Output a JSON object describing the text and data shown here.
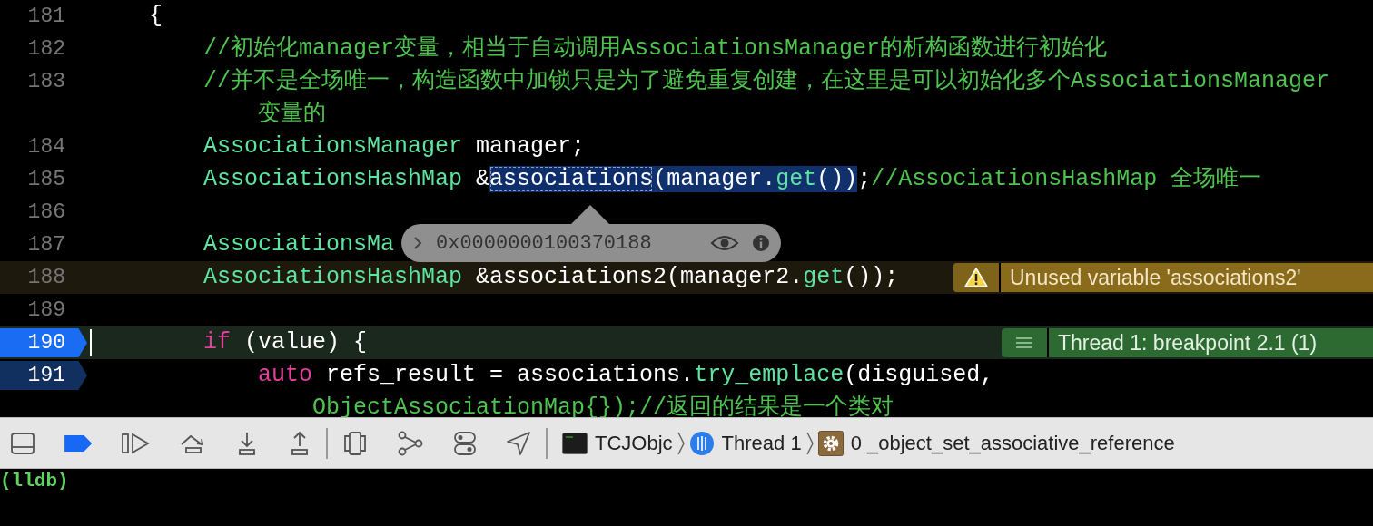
{
  "editor": {
    "lines": [
      {
        "number": "181",
        "tokens": [
          {
            "text": "    {",
            "kind": "plain"
          }
        ]
      },
      {
        "number": "182",
        "tokens": [
          {
            "text": "        //初始化manager变量，相当于自动调用AssociationsManager的析构函数进行初始化",
            "kind": "comment"
          }
        ]
      },
      {
        "number": "183",
        "tokens": [
          {
            "text": "        //并不是全场唯一，构造函数中加锁只是为了避免重复创建，在这里是可以初始化多个AssociationsManager",
            "kind": "comment"
          }
        ],
        "continuation": [
          {
            "text": "            变量的",
            "kind": "comment"
          }
        ]
      },
      {
        "number": "184",
        "tokens": [
          {
            "text": "        AssociationsManager",
            "kind": "type"
          },
          {
            "text": " manager;",
            "kind": "plain"
          }
        ]
      },
      {
        "number": "185",
        "tokens": [
          {
            "text": "        AssociationsHashMap",
            "kind": "type"
          },
          {
            "text": " &",
            "kind": "plain"
          },
          {
            "text": "associations",
            "kind": "plain",
            "selected": true
          },
          {
            "text": "(manager.",
            "kind": "plain",
            "highlighted": true
          },
          {
            "text": "get",
            "kind": "func",
            "highlighted": true
          },
          {
            "text": "())",
            "kind": "plain",
            "highlighted": true
          },
          {
            "text": ";",
            "kind": "plain"
          },
          {
            "text": "//AssociationsHashMap 全场唯一",
            "kind": "comment"
          }
        ]
      },
      {
        "number": "186"
      },
      {
        "number": "187",
        "tokens": [
          {
            "text": "        AssociationsMa",
            "kind": "type"
          }
        ]
      },
      {
        "number": "188",
        "warning": true,
        "tokens": [
          {
            "text": "        AssociationsHashMap",
            "kind": "type"
          },
          {
            "text": " &associations2(manager2.",
            "kind": "plain"
          },
          {
            "text": "get",
            "kind": "func"
          },
          {
            "text": "());",
            "kind": "plain"
          }
        ],
        "annotation": {
          "kind": "warning",
          "text": "Unused variable 'associations2'"
        }
      },
      {
        "number": "189"
      },
      {
        "number": "190",
        "breakpoint": true,
        "breakpoint_enabled": true,
        "current": true,
        "tokens": [
          {
            "text": "        if",
            "kind": "keyword"
          },
          {
            "text": " (value) {",
            "kind": "plain"
          }
        ],
        "annotation": {
          "kind": "thread",
          "text": "Thread 1: breakpoint 2.1 (1)"
        }
      },
      {
        "number": "191",
        "breakpoint": true,
        "breakpoint_enabled": false,
        "tokens": [
          {
            "text": "            auto",
            "kind": "keyword"
          },
          {
            "text": " refs_result = associations.",
            "kind": "plain"
          },
          {
            "text": "try_emplace",
            "kind": "func"
          },
          {
            "text": "(disguised,",
            "kind": "plain"
          }
        ],
        "continuation": [
          {
            "text": "                ObjectAssociationMap{});//返回的结果是一个类对",
            "kind": "comment"
          }
        ]
      }
    ],
    "popover": {
      "value": "0x0000000100370188"
    }
  },
  "debug_bar": {
    "breakpoints_active": true,
    "breadcrumbs": [
      {
        "kind": "app",
        "label": "TCJObjc"
      },
      {
        "kind": "thread",
        "label": "Thread 1"
      },
      {
        "kind": "frame",
        "label": "0 _object_set_associative_reference"
      }
    ]
  },
  "console": {
    "prompt": "(lldb)"
  }
}
